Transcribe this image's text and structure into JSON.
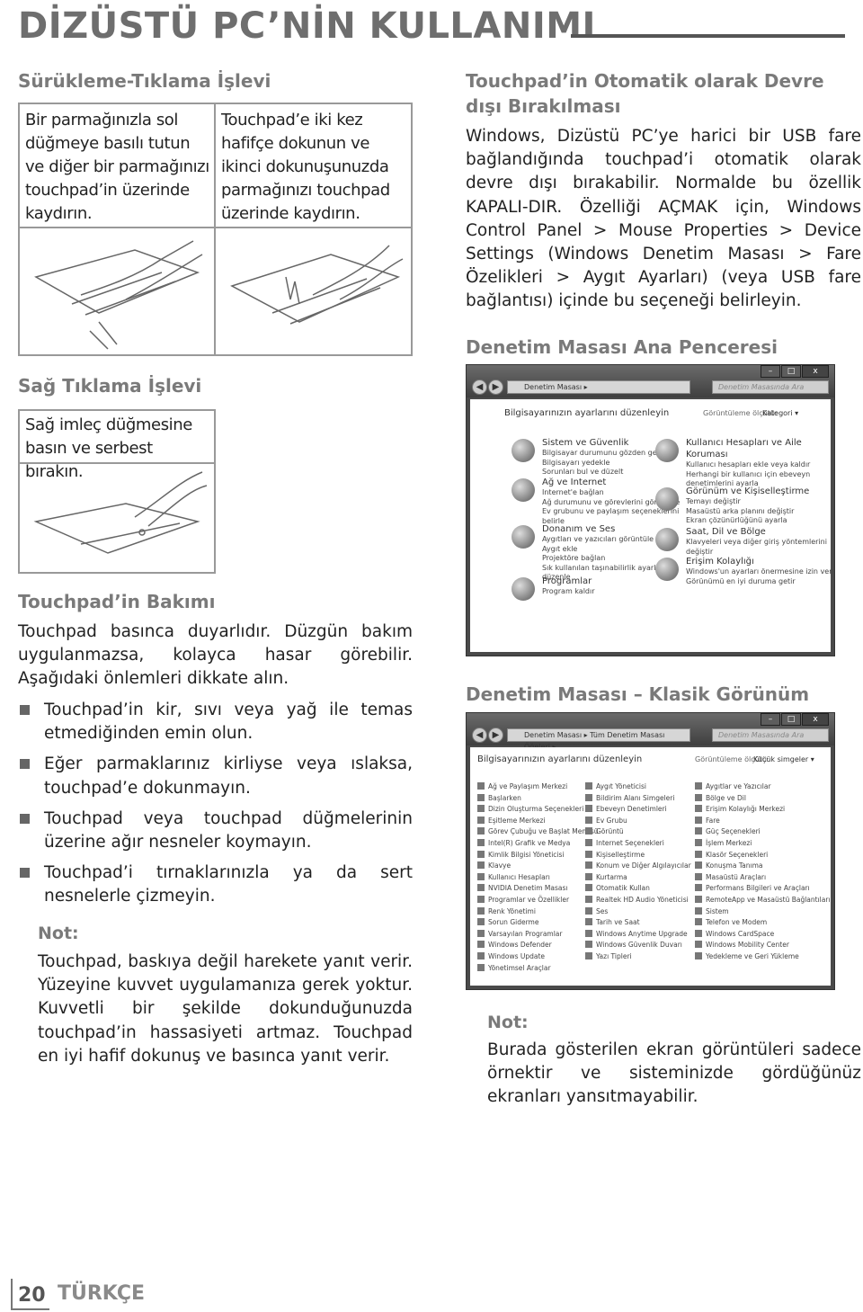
{
  "header": {
    "title": "DİZÜSTÜ PC’NİN KULLANIMI"
  },
  "left": {
    "drag_click": {
      "heading": "Sürükleme-Tıklama İşlevi",
      "cell1": "Bir parmağınızla sol düğmeye basılı tutun ve diğer bir parmağınızı touchpad’in üzerinde kaydırın.",
      "cell2": "Touchpad’e iki kez hafifçe dokunun ve ikinci dokunuşunuzda parmağınızı touchpad üzerinde kaydırın."
    },
    "right_click": {
      "heading": "Sağ Tıklama İşlevi",
      "cell": "Sağ imleç düğmesine basın ve serbest bırakın."
    },
    "care": {
      "heading": "Touchpad’in Bakımı",
      "intro": "Touchpad basınca duyarlıdır. Düzgün bakım uygulanmazsa, kolayca hasar görebilir. Aşağıdaki önlemleri dikkate alın.",
      "bullets": [
        "Touchpad’in kir, sıvı veya yağ ile temas etmediğinden emin olun.",
        "Eğer parmaklarınız kirliyse veya ıslaksa, touchpad’e dokunmayın.",
        "Touchpad veya touchpad düğmelerinin üzerine ağır nesneler koymayın.",
        "Touchpad’i tırnaklarınızla ya da sert nesnelerle çizmeyin."
      ],
      "note_label": "Not:",
      "note": "Touchpad, baskıya değil harekete yanıt verir. Yüzeyine kuvvet uygulamanıza gerek yoktur. Kuvvetli bir şekilde dokunduğunuzda touchpad’in hassasiyeti artmaz. Touchpad en iyi hafif dokunuş ve basınca yanıt verir."
    }
  },
  "right": {
    "auto_disable": {
      "heading": "Touchpad’in Otomatik olarak Devre dışı Bırakılması",
      "body": "Windows, Dizüstü PC’ye harici bir USB fare bağlandığında touchpad’i otomatik olarak devre dışı bırakabilir. Normalde bu özellik KAPALI-DIR. Özelliği AÇMAK için, Windows Control Panel > Mouse Properties > Device Settings (Windows Denetim Masası > Fare Özelikleri > Aygıt Ayarları) (veya USB fare bağlantısı) içinde bu seçeneği belirleyin."
    },
    "cp_main": {
      "heading": "Denetim Masası Ana Penceresi",
      "address": "Denetim Masası ▸",
      "search": "Denetim Masasında Ara",
      "title": "Bilgisayarınızın ayarlarını düzenleyin",
      "view_label": "Görüntüleme ölçütü:",
      "view_value": "Kategori ▾",
      "left_items": [
        {
          "title": "Sistem ve Güvenlik",
          "links": [
            "Bilgisayar durumunu gözden geçir",
            "Bilgisayarı yedekle",
            "Sorunları bul ve düzelt"
          ]
        },
        {
          "title": "Ağ ve Internet",
          "links": [
            "Internet'e bağlan",
            "Ağ durumunu ve görevlerini görüntüle",
            "Ev grubunu ve paylaşım seçeneklerini belirle"
          ]
        },
        {
          "title": "Donanım ve Ses",
          "links": [
            "Aygıtları ve yazıcıları görüntüle",
            "Aygıt ekle",
            "Projektöre bağlan",
            "Sık kullanılan taşınabilirlik ayarlarını düzenle"
          ]
        },
        {
          "title": "Programlar",
          "links": [
            "Program kaldır"
          ]
        }
      ],
      "right_items": [
        {
          "title": "Kullanıcı Hesapları ve Aile Koruması",
          "links": [
            "Kullanıcı hesapları ekle veya kaldır",
            "Herhangi bir kullanıcı için ebeveyn denetimlerini ayarla"
          ]
        },
        {
          "title": "Görünüm ve Kişiselleştirme",
          "links": [
            "Temayı değiştir",
            "Masaüstü arka planını değiştir",
            "Ekran çözünürlüğünü ayarla"
          ]
        },
        {
          "title": "Saat, Dil ve Bölge",
          "links": [
            "Klavyeleri veya diğer giriş yöntemlerini değiştir"
          ]
        },
        {
          "title": "Erişim Kolaylığı",
          "links": [
            "Windows'un ayarları önermesine izin ver",
            "Görünümü en iyi duruma getir"
          ]
        }
      ]
    },
    "cp_classic": {
      "heading": "Denetim Masası – Klasik Görünüm",
      "address": "Denetim Masası ▸ Tüm Denetim Masası Öğeleri ▸",
      "search": "Denetim Masasında Ara",
      "title": "Bilgisayarınızın ayarlarını düzenleyin",
      "view_label": "Görüntüleme ölçütü:",
      "view_value": "Küçük simgeler ▾",
      "columns": [
        [
          "Ağ ve Paylaşım Merkezi",
          "Başlarken",
          "Dizin Oluşturma Seçenekleri",
          "Eşitleme Merkezi",
          "Görev Çubuğu ve Başlat Menüsü",
          "Intel(R) Grafik ve Medya",
          "Kimlik Bilgisi Yöneticisi",
          "Klavye",
          "Kullanıcı Hesapları",
          "NVIDIA Denetim Masası",
          "Programlar ve Özellikler",
          "Renk Yönetimi",
          "Sorun Giderme",
          "Varsayılan Programlar",
          "Windows Defender",
          "Windows Update",
          "Yönetimsel Araçlar"
        ],
        [
          "Aygıt Yöneticisi",
          "Bildirim Alanı Simgeleri",
          "Ebeveyn Denetimleri",
          "Ev Grubu",
          "Görüntü",
          "Internet Seçenekleri",
          "Kişiselleştirme",
          "Konum ve Diğer Algılayıcılar",
          "Kurtarma",
          "Otomatik Kullan",
          "Realtek HD Audio Yöneticisi",
          "Ses",
          "Tarih ve Saat",
          "Windows Anytime Upgrade",
          "Windows Güvenlik Duvarı",
          "Yazı Tipleri"
        ],
        [
          "Aygıtlar ve Yazıcılar",
          "Bölge ve Dil",
          "Erişim Kolaylığı Merkezi",
          "Fare",
          "Güç Seçenekleri",
          "İşlem Merkezi",
          "Klasör Seçenekleri",
          "Konuşma Tanıma",
          "Masaüstü Araçları",
          "Performans Bilgileri ve Araçları",
          "RemoteApp ve Masaüstü Bağlantıları",
          "Sistem",
          "Telefon ve Modem",
          "Windows CardSpace",
          "Windows Mobility Center",
          "Yedekleme ve Geri Yükleme"
        ]
      ]
    },
    "note_label": "Not:",
    "note": "Burada gösterilen ekran görüntüleri sadece örnektir ve sisteminizde gördüğünüz ekranları yansıtmayabilir."
  },
  "footer": {
    "page": "20",
    "language": "TÜRKÇE"
  }
}
